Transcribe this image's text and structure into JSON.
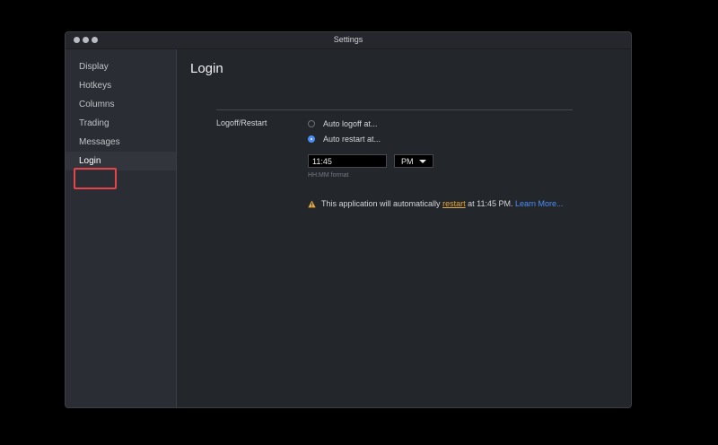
{
  "window": {
    "title": "Settings"
  },
  "sidebar": {
    "items": [
      {
        "label": "Display"
      },
      {
        "label": "Hotkeys"
      },
      {
        "label": "Columns"
      },
      {
        "label": "Trading"
      },
      {
        "label": "Messages"
      },
      {
        "label": "Login",
        "active": true
      }
    ]
  },
  "content": {
    "title": "Login",
    "section_label": "Logoff/Restart",
    "options": [
      {
        "label": "Auto logoff at...",
        "selected": false
      },
      {
        "label": "Auto restart at...",
        "selected": true
      }
    ],
    "time_input": {
      "value": "11:45",
      "helper": "HH:MM format"
    },
    "ampm": {
      "selected": "PM"
    },
    "notice": {
      "icon": "warning-icon",
      "prefix": "This application will automatically",
      "link_text": "restart",
      "suffix": "at 11:45 PM.",
      "learn_more": "Learn More..."
    }
  },
  "colors": {
    "accent": "#4a8ff7",
    "warning": "#e6a93b",
    "highlight": "#e8434a"
  }
}
